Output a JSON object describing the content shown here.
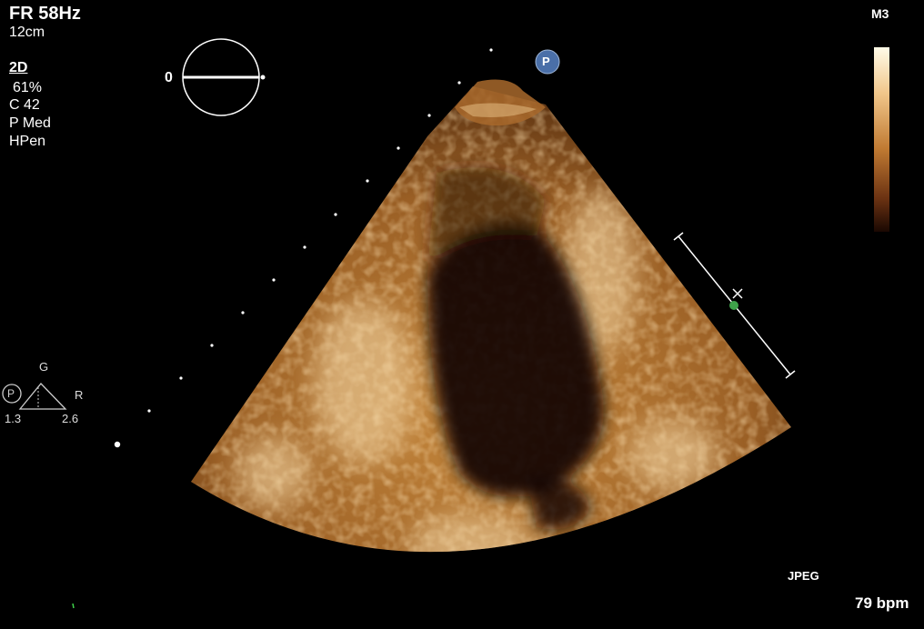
{
  "header": {
    "frame_rate": "FR 58Hz",
    "depth": "12cm"
  },
  "settings": {
    "mode": "2D",
    "gain": "61%",
    "compression": "C 42",
    "power": "P Med",
    "harmonic": "HPen"
  },
  "probe": {
    "angle": "0",
    "marker": "P"
  },
  "colormap": {
    "label": "M3",
    "colors": [
      "#fffbe8",
      "#f1c68a",
      "#c07a32",
      "#6b3212",
      "#1a0802"
    ]
  },
  "orientation": {
    "marker": "P",
    "top": "G",
    "right": "R",
    "left_value": "1.3",
    "right_value": "2.6"
  },
  "footer": {
    "format": "JPEG",
    "heart_rate": "79 bpm"
  },
  "image": {
    "tissue_color": "#c88a3e",
    "bright_color": "#f5d9a8",
    "cavity_color": "#0a0603"
  }
}
